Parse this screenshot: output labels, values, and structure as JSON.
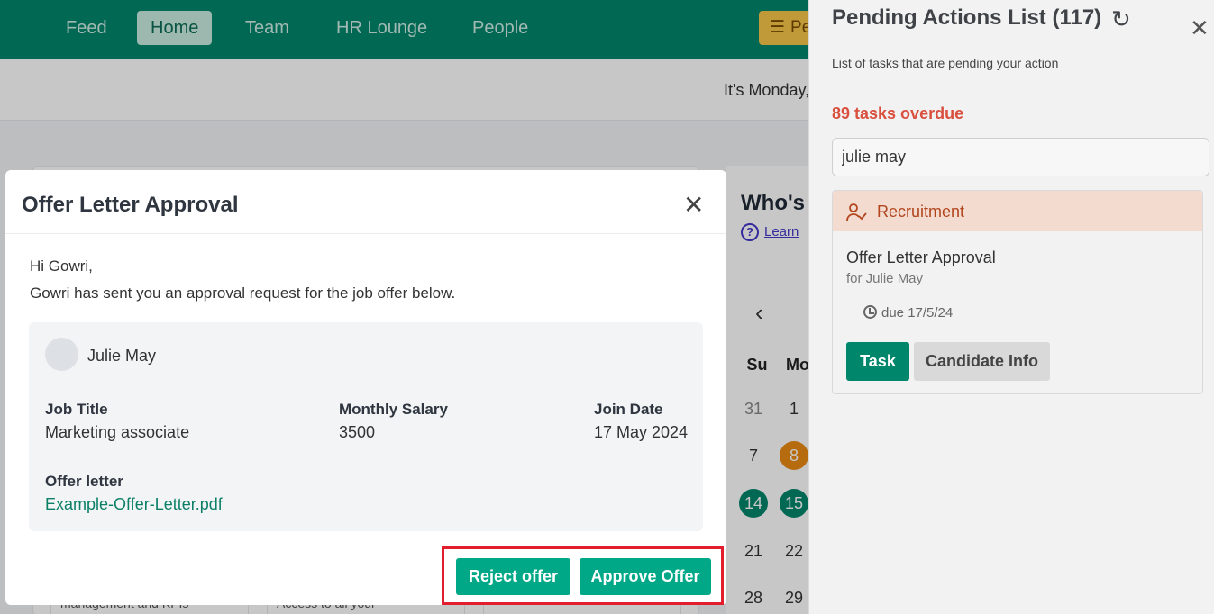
{
  "nav": {
    "items": [
      {
        "label": "Feed"
      },
      {
        "label": "Home"
      },
      {
        "label": "Team"
      },
      {
        "label": "HR Lounge"
      },
      {
        "label": "People"
      }
    ],
    "active": "Home",
    "pending_button_label": "Pe"
  },
  "page": {
    "greeting": "It's Monday,",
    "bottom_snippets": [
      "management and KPIs",
      "Access to all your"
    ]
  },
  "whos_panel": {
    "title": "Who's",
    "learn_link": "Learn",
    "calendar": {
      "headers": [
        "Su",
        "Mo"
      ],
      "rows": [
        [
          "31",
          "1"
        ],
        [
          "7",
          "8"
        ],
        [
          "14",
          "15"
        ],
        [
          "21",
          "22"
        ],
        [
          "28",
          "29"
        ]
      ]
    }
  },
  "pending_panel": {
    "title": "Pending Actions List (117)",
    "subtitle": "List of tasks that are pending your action",
    "overdue": "89 tasks overdue",
    "search_value": "julie may",
    "task": {
      "category": "Recruitment",
      "title": "Offer Letter Approval",
      "for": "for Julie May",
      "due": "due 17/5/24",
      "task_button": "Task",
      "candidate_button": "Candidate Info"
    },
    "colors": {
      "overdue": "#d9503f",
      "category_bg": "#f4dbd0",
      "category_text": "#b1461d"
    }
  },
  "modal": {
    "title": "Offer Letter Approval",
    "greeting": "Hi Gowri,",
    "message": "Gowri has sent you an approval request for the job offer below.",
    "candidate_name": "Julie May",
    "fields": {
      "job_title_label": "Job Title",
      "job_title_value": "Marketing associate",
      "salary_label": "Monthly Salary",
      "salary_value": "3500",
      "join_label": "Join Date",
      "join_value": "17 May 2024",
      "offer_label": "Offer letter",
      "offer_file": "Example-Offer-Letter.pdf"
    },
    "reject_button": "Reject offer",
    "approve_button": "Approve Offer",
    "colors": {
      "primary": "#00a887",
      "highlight": "#e11d2e"
    }
  },
  "icons": [
    "checklist-icon",
    "refresh-icon",
    "close-icon",
    "person-check-icon",
    "clock-icon",
    "help-circle-icon",
    "chevron-left-icon"
  ]
}
